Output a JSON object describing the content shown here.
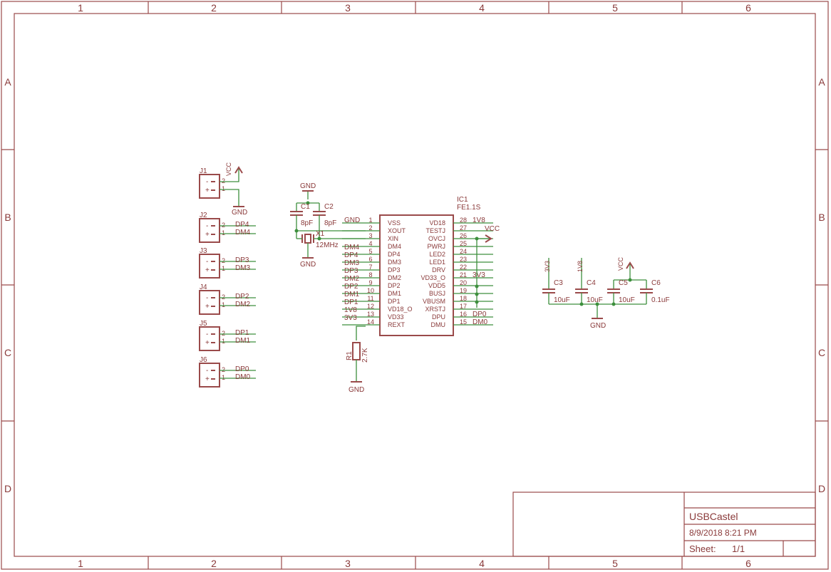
{
  "frame": {
    "columns": [
      "1",
      "2",
      "3",
      "4",
      "5",
      "6"
    ],
    "rows": [
      "A",
      "B",
      "C",
      "D"
    ]
  },
  "title_block": {
    "name": "USBCastel",
    "date": "8/9/2018 8:21 PM",
    "sheet_label": "Sheet:",
    "sheet_value": "1/1"
  },
  "supplies": {
    "vcc": "VCC",
    "gnd": "GND",
    "v3v3": "3V3",
    "v1v8": "1V8"
  },
  "connectors": [
    {
      "ref": "J1",
      "pin2": "2",
      "pin1": "1",
      "net2": "",
      "net1": ""
    },
    {
      "ref": "J2",
      "pin2": "2",
      "pin1": "1",
      "net2": "DP4",
      "net1": "DM4"
    },
    {
      "ref": "J3",
      "pin2": "2",
      "pin1": "1",
      "net2": "DP3",
      "net1": "DM3"
    },
    {
      "ref": "J4",
      "pin2": "2",
      "pin1": "1",
      "net2": "DP2",
      "net1": "DM2"
    },
    {
      "ref": "J5",
      "pin2": "2",
      "pin1": "1",
      "net2": "DP1",
      "net1": "DM1"
    },
    {
      "ref": "J6",
      "pin2": "2",
      "pin1": "1",
      "net2": "DP0",
      "net1": "DM0"
    }
  ],
  "crystal": {
    "c1_ref": "C1",
    "c1_value": "8pF",
    "c2_ref": "C2",
    "c2_value": "8pF",
    "x1_ref": "X1",
    "x1_value": "12MHz"
  },
  "ic": {
    "ref": "IC1",
    "value": "FE1.1S",
    "left_pins": [
      {
        "num": "1",
        "name": "VSS",
        "net": "GND"
      },
      {
        "num": "2",
        "name": "XOUT",
        "net": ""
      },
      {
        "num": "3",
        "name": "XIN",
        "net": ""
      },
      {
        "num": "4",
        "name": "DM4",
        "net": "DM4"
      },
      {
        "num": "5",
        "name": "DP4",
        "net": "DP4"
      },
      {
        "num": "6",
        "name": "DM3",
        "net": "DM3"
      },
      {
        "num": "7",
        "name": "DP3",
        "net": "DP3"
      },
      {
        "num": "8",
        "name": "DM2",
        "net": "DM2"
      },
      {
        "num": "9",
        "name": "DP2",
        "net": "DP2"
      },
      {
        "num": "10",
        "name": "DM1",
        "net": "DM1"
      },
      {
        "num": "11",
        "name": "DP1",
        "net": "DP1"
      },
      {
        "num": "12",
        "name": "VD18_O",
        "net": "1V8"
      },
      {
        "num": "13",
        "name": "VD33",
        "net": "3V3"
      },
      {
        "num": "14",
        "name": "REXT",
        "net": ""
      }
    ],
    "right_pins": [
      {
        "num": "28",
        "name": "VD18",
        "net": "1V8"
      },
      {
        "num": "27",
        "name": "TESTJ",
        "net": ""
      },
      {
        "num": "26",
        "name": "OVCJ",
        "net": ""
      },
      {
        "num": "25",
        "name": "PWRJ",
        "net": ""
      },
      {
        "num": "24",
        "name": "LED2",
        "net": ""
      },
      {
        "num": "23",
        "name": "LED1",
        "net": ""
      },
      {
        "num": "22",
        "name": "DRV",
        "net": ""
      },
      {
        "num": "21",
        "name": "VD33_O",
        "net": "3V3"
      },
      {
        "num": "20",
        "name": "VDD5",
        "net": ""
      },
      {
        "num": "19",
        "name": "BUSJ",
        "net": ""
      },
      {
        "num": "18",
        "name": "VBUSM",
        "net": ""
      },
      {
        "num": "17",
        "name": "XRSTJ",
        "net": ""
      },
      {
        "num": "16",
        "name": "DPU",
        "net": "DP0"
      },
      {
        "num": "15",
        "name": "DMU",
        "net": "DM0"
      }
    ]
  },
  "rext": {
    "ref": "R1",
    "value": "2.7K"
  },
  "decoupling": [
    {
      "ref": "C3",
      "value": "10uF",
      "rail": "3V3"
    },
    {
      "ref": "C4",
      "value": "10uF",
      "rail": "1V8"
    },
    {
      "ref": "C5",
      "value": "10uF",
      "rail": "VCC"
    },
    {
      "ref": "C6",
      "value": "0.1uF",
      "rail": ""
    }
  ]
}
